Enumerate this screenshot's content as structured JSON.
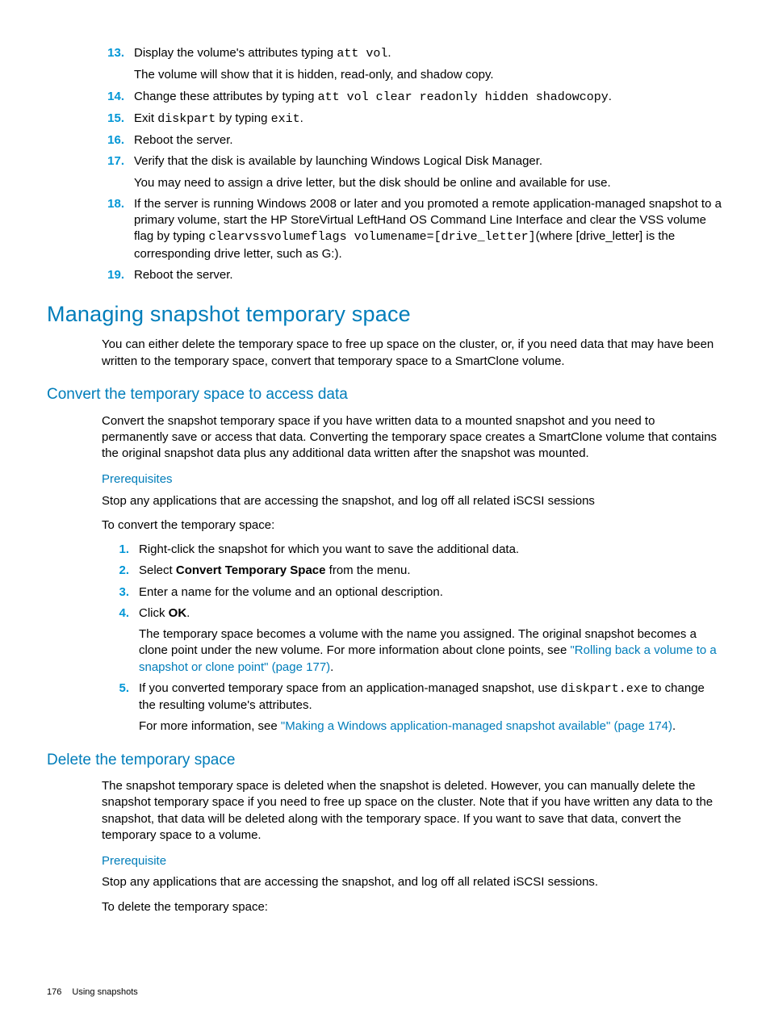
{
  "list1": [
    {
      "n": "13.",
      "lines": [
        {
          "t": "seg",
          "parts": [
            {
              "txt": "Display the volume's attributes typing "
            },
            {
              "txt": "att vol",
              "mono": true
            },
            {
              "txt": "."
            }
          ]
        },
        {
          "t": "plain",
          "txt": "The volume will show that it is hidden, read-only, and shadow copy."
        }
      ]
    },
    {
      "n": "14.",
      "lines": [
        {
          "t": "seg",
          "parts": [
            {
              "txt": "Change these attributes by typing "
            },
            {
              "txt": "att vol clear readonly hidden shadowcopy",
              "mono": true
            },
            {
              "txt": "."
            }
          ]
        }
      ]
    },
    {
      "n": "15.",
      "lines": [
        {
          "t": "seg",
          "parts": [
            {
              "txt": "Exit "
            },
            {
              "txt": "diskpart",
              "mono": true
            },
            {
              "txt": " by typing "
            },
            {
              "txt": "exit",
              "mono": true
            },
            {
              "txt": "."
            }
          ]
        }
      ]
    },
    {
      "n": "16.",
      "lines": [
        {
          "t": "plain",
          "txt": "Reboot the server."
        }
      ]
    },
    {
      "n": "17.",
      "lines": [
        {
          "t": "plain",
          "txt": "Verify that the disk is available by launching Windows Logical Disk Manager."
        },
        {
          "t": "plain",
          "txt": "You may need to assign a drive letter, but the disk should be online and available for use."
        }
      ]
    },
    {
      "n": "18.",
      "lines": [
        {
          "t": "seg",
          "parts": [
            {
              "txt": "If the server is running Windows 2008 or later and you promoted a remote application-managed snapshot to a primary volume, start the HP StoreVirtual LeftHand OS Command Line Interface and clear the VSS volume flag by typing "
            },
            {
              "txt": "clearvssvolumeflags volumename=[drive_letter]",
              "mono": true
            },
            {
              "txt": "(where [drive_letter] is the corresponding drive letter, such as G:)."
            }
          ]
        }
      ]
    },
    {
      "n": "19.",
      "lines": [
        {
          "t": "plain",
          "txt": "Reboot the server."
        }
      ]
    }
  ],
  "h2_managing": "Managing snapshot temporary space",
  "p_managing": "You can either delete the temporary space to free up space on the cluster, or, if you need data that may have been written to the temporary space, convert that temporary space to a SmartClone volume.",
  "h3_convert": "Convert the temporary space to access data",
  "p_convert": "Convert the snapshot temporary space if you have written data to a mounted snapshot and you need to permanently save or access that data. Converting the temporary space creates a SmartClone volume that contains the original snapshot data plus any additional data written after the snapshot was mounted.",
  "h4_prereq1": "Prerequisites",
  "p_prereq1": "Stop any applications that are accessing the snapshot, and log off all related iSCSI sessions",
  "p_toconvert": "To convert the temporary space:",
  "list2": [
    {
      "n": "1.",
      "lines": [
        {
          "t": "plain",
          "txt": "Right-click the snapshot for which you want to save the additional data."
        }
      ]
    },
    {
      "n": "2.",
      "lines": [
        {
          "t": "seg",
          "parts": [
            {
              "txt": "Select "
            },
            {
              "txt": "Convert Temporary Space",
              "bold": true
            },
            {
              "txt": " from the menu."
            }
          ]
        }
      ]
    },
    {
      "n": "3.",
      "lines": [
        {
          "t": "plain",
          "txt": "Enter a name for the volume and an optional description."
        }
      ]
    },
    {
      "n": "4.",
      "lines": [
        {
          "t": "seg",
          "parts": [
            {
              "txt": "Click "
            },
            {
              "txt": "OK",
              "bold": true
            },
            {
              "txt": "."
            }
          ]
        },
        {
          "t": "seg",
          "parts": [
            {
              "txt": "The temporary space becomes a volume with the name you assigned. The original snapshot becomes a clone point under the new volume. For more information about clone points, see "
            },
            {
              "txt": "\"Rolling back a volume to a snapshot or clone point\" (page 177)",
              "link": true
            },
            {
              "txt": "."
            }
          ]
        }
      ]
    },
    {
      "n": "5.",
      "lines": [
        {
          "t": "seg",
          "parts": [
            {
              "txt": "If you converted temporary space from an application-managed snapshot, use "
            },
            {
              "txt": "diskpart.exe",
              "mono": true
            },
            {
              "txt": " to change the resulting volume's attributes."
            }
          ]
        },
        {
          "t": "seg",
          "parts": [
            {
              "txt": "For more information, see "
            },
            {
              "txt": "\"Making a Windows application-managed snapshot available\" (page 174)",
              "link": true
            },
            {
              "txt": "."
            }
          ]
        }
      ]
    }
  ],
  "h3_delete": "Delete the temporary space",
  "p_delete": "The snapshot temporary space is deleted when the snapshot is deleted. However, you can manually delete the snapshot temporary space if you need to free up space on the cluster. Note that if you have written any data to the snapshot, that data will be deleted along with the temporary space. If you want to save that data, convert the temporary space to a volume.",
  "h4_prereq2": "Prerequisite",
  "p_prereq2": "Stop any applications that are accessing the snapshot, and log off all related iSCSI sessions.",
  "p_todelete": "To delete the temporary space:",
  "footer_page": "176",
  "footer_text": "Using snapshots"
}
